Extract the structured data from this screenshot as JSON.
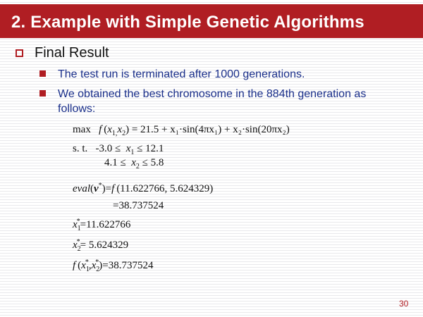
{
  "slide": {
    "title": "2. Example with Simple Genetic Algorithms",
    "section_heading": "Final Result",
    "bullets": [
      "The test run is terminated after 1000 generations.",
      "We obtained the best chromosome in the 884th generation as follows:"
    ],
    "page_number": "30",
    "accent_color": "#b01e23",
    "bullet_text_color": "#1a2f8a"
  },
  "math": {
    "max_label": "max",
    "objective_rhs": "= 21.5 + x₁·sin(4πx₁) + x₂·sin(20πx₂)",
    "st_label": "s. t.",
    "constraint1_lower": "-3.0 ≤",
    "constraint1_upper": "≤ 12.1",
    "constraint2_lower": "4.1 ≤",
    "constraint2_upper": "≤ 5.8",
    "eval_expr_args": "(11.622766,  5.624329)",
    "eval_result": "=38.737524",
    "x1_value": "=11.622766",
    "x2_value": "=  5.624329",
    "f_value": "=38.737524"
  }
}
